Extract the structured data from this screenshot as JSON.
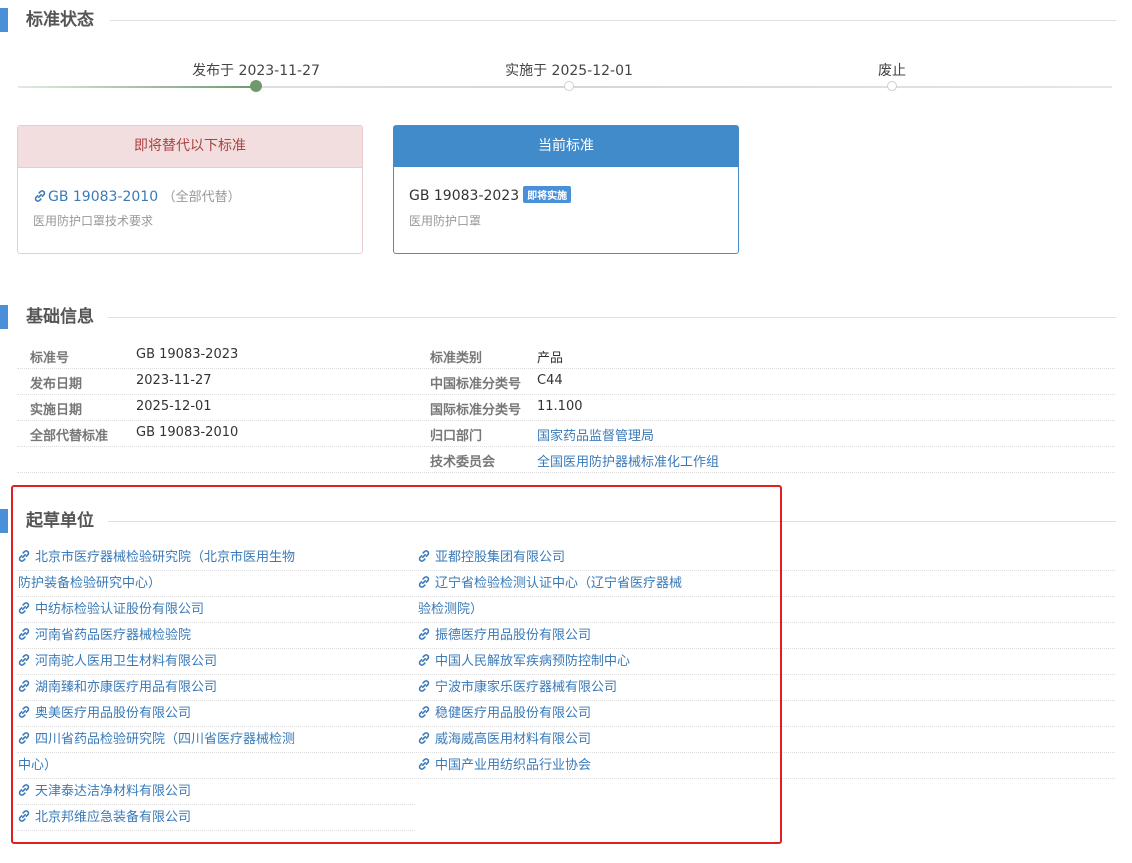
{
  "sections": {
    "status_title": "标准状态",
    "basic_title": "基础信息",
    "drafters_title": "起草单位"
  },
  "timeline": {
    "published": "发布于 2023-11-27",
    "implemented": "实施于 2025-12-01",
    "abolished": "废止"
  },
  "replace_card": {
    "header": "即将替代以下标准",
    "code": "GB 19083-2010",
    "note": "（全部代替）",
    "name": "医用防护口罩技术要求"
  },
  "current_card": {
    "header": "当前标准",
    "code": "GB 19083-2023",
    "badge": "即将实施",
    "name": "医用防护口罩"
  },
  "basic_info": {
    "left": [
      {
        "label": "标准号",
        "value": "GB 19083-2023"
      },
      {
        "label": "发布日期",
        "value": "2023-11-27"
      },
      {
        "label": "实施日期",
        "value": "2025-12-01"
      },
      {
        "label": "全部代替标准",
        "value": "GB 19083-2010"
      }
    ],
    "right": [
      {
        "label": "标准类别",
        "value": "产品"
      },
      {
        "label": "中国标准分类号",
        "value": "C44"
      },
      {
        "label": "国际标准分类号",
        "value": "11.100"
      },
      {
        "label": "归口部门",
        "value": "国家药品监督管理局"
      },
      {
        "label": "技术委员会",
        "value": "全国医用防护器械标准化工作组"
      }
    ]
  },
  "drafters": {
    "left": [
      {
        "line1": "北京市医疗器械检验研究院（北京市医用生物",
        "line2": "防护装备检验研究中心）"
      },
      {
        "line1": "中纺标检验认证股份有限公司"
      },
      {
        "line1": "河南省药品医疗器械检验院"
      },
      {
        "line1": "河南驼人医用卫生材料有限公司"
      },
      {
        "line1": "湖南臻和亦康医疗用品有限公司"
      },
      {
        "line1": "奥美医疗用品股份有限公司"
      },
      {
        "line1": "四川省药品检验研究院（四川省医疗器械检测",
        "line2": "中心）"
      },
      {
        "line1": "天津泰达洁净材料有限公司"
      },
      {
        "line1": "北京邦维应急装备有限公司"
      }
    ],
    "right": [
      {
        "line1": "亚都控股集团有限公司"
      },
      {
        "line1": "辽宁省检验检测认证中心（辽宁省医疗器械",
        "line2": "验检测院）"
      },
      {
        "line1": "振德医疗用品股份有限公司"
      },
      {
        "line1": "中国人民解放军疾病预防控制中心"
      },
      {
        "line1": "宁波市康家乐医疗器械有限公司"
      },
      {
        "line1": "稳健医疗用品股份有限公司"
      },
      {
        "line1": "威海威高医用材料有限公司"
      },
      {
        "line1": "中国产业用纺织品行业协会"
      }
    ]
  },
  "colors": {
    "accent": "#4a90d9",
    "link": "#3a7ab8",
    "timeline_active": "#6f9a6c",
    "replace_bg": "#f2dede",
    "replace_text": "#a94442",
    "highlight_border": "#e02020"
  }
}
